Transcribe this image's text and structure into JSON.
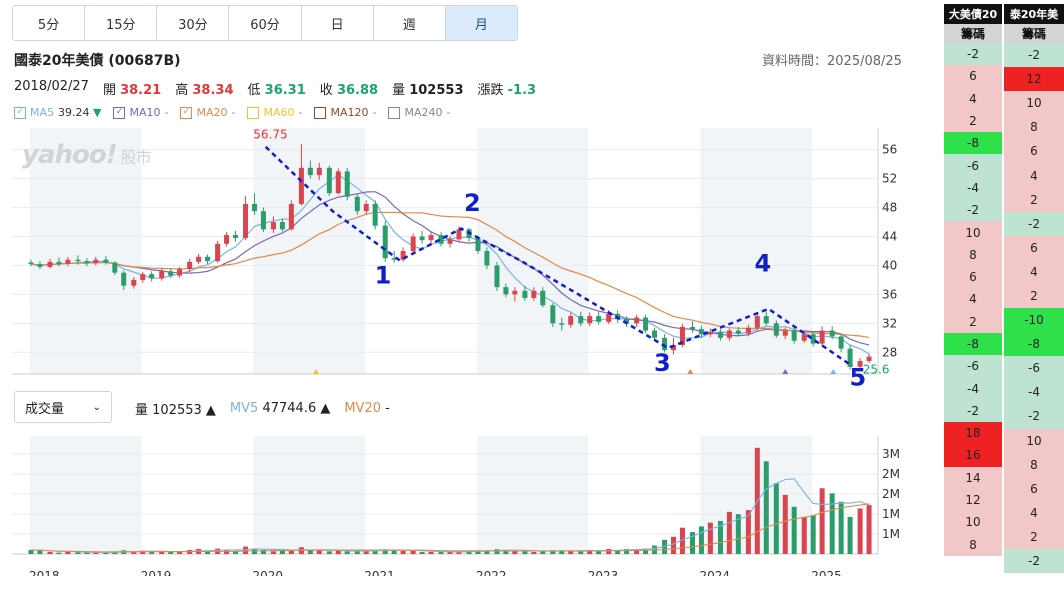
{
  "tabs": [
    {
      "label": "5分",
      "active": false
    },
    {
      "label": "15分",
      "active": false
    },
    {
      "label": "30分",
      "active": false
    },
    {
      "label": "60分",
      "active": false
    },
    {
      "label": "日",
      "active": false
    },
    {
      "label": "週",
      "active": false
    },
    {
      "label": "月",
      "active": true
    }
  ],
  "header": {
    "title": "國泰20年美債 (00687B)",
    "updated": "資料時間：2025/08/25"
  },
  "quote": {
    "date": "2018/02/27",
    "open_label": "開",
    "open": "38.21",
    "high_label": "高",
    "high": "38.34",
    "low_label": "低",
    "low": "36.31",
    "close_label": "收",
    "close": "36.88",
    "vol_label": "量",
    "vol": "102553",
    "chg_label": "漲跌",
    "chg": "-1.3"
  },
  "ma_legend": [
    {
      "label": "MA5",
      "value": "39.24 ▼",
      "color": "#7ab3e0",
      "checked": true
    },
    {
      "label": "MA10",
      "value": "-",
      "color": "#7b68b3",
      "checked": true
    },
    {
      "label": "MA20",
      "value": "-",
      "color": "#e08a4a",
      "checked": true
    },
    {
      "label": "MA60",
      "value": "-",
      "color": "#f2c230",
      "checked": false
    },
    {
      "label": "MA120",
      "value": "-",
      "color": "#8a4b2e",
      "checked": false
    },
    {
      "label": "MA240",
      "value": "-",
      "color": "#888888",
      "checked": false
    }
  ],
  "watermark": {
    "logo": "yahoo!",
    "suffix": "股市"
  },
  "volume_panel": {
    "select_label": "成交量",
    "vol_label": "量",
    "vol_value": "102553 ▲",
    "mv5_label": "MV5",
    "mv5_value": "47744.6 ▲",
    "mv20_label": "MV20",
    "mv20_value": "-"
  },
  "colors": {
    "up": "#d8454f",
    "down": "#2a9d6b",
    "ma5": "#7ab3e0",
    "ma10": "#7b68b3",
    "ma20": "#e08a4a",
    "pattern": "#1020c8",
    "band": "#f2f5f8"
  },
  "chart_data": {
    "type": "candlestick",
    "price_axis": {
      "ticks": [
        "56",
        "52",
        "48",
        "44",
        "40",
        "36",
        "32",
        "28"
      ],
      "range": [
        25,
        59
      ]
    },
    "volume_axis": {
      "ticks": [
        "3M",
        "2M",
        "2M",
        "1M",
        "1M"
      ],
      "range": [
        0,
        3500000
      ]
    },
    "x_ticks": [
      "2018",
      "2019",
      "2020",
      "2021",
      "2022",
      "2023",
      "2024",
      "2025"
    ],
    "x_range": [
      2017.83,
      2025.58
    ],
    "annotations": {
      "high_label": "56.75",
      "high_at": [
        2020.0,
        56.75
      ],
      "low_label": "25.6",
      "low_at": [
        2025.42,
        25.6
      ]
    },
    "pattern_labels": [
      {
        "text": "1",
        "at": [
          2021.15,
          37.5
        ]
      },
      {
        "text": "2",
        "at": [
          2021.95,
          47.5
        ]
      },
      {
        "text": "3",
        "at": [
          2023.65,
          25.4
        ]
      },
      {
        "text": "4",
        "at": [
          2024.55,
          39.2
        ]
      },
      {
        "text": "5",
        "at": [
          2025.4,
          23.4
        ]
      }
    ],
    "pattern_path": [
      [
        2020.1,
        56.4
      ],
      [
        2020.7,
        47.5
      ],
      [
        2021.3,
        40.7
      ],
      [
        2021.85,
        45.1
      ],
      [
        2022.4,
        40.5
      ],
      [
        2022.9,
        36.0
      ],
      [
        2023.7,
        28.6
      ],
      [
        2024.6,
        34.0
      ],
      [
        2025.35,
        26.1
      ]
    ],
    "candles": [
      [
        2018.0,
        40.4,
        40.2,
        40.8,
        39.9,
        3
      ],
      [
        2018.08,
        40.2,
        39.8,
        40.6,
        39.5,
        3
      ],
      [
        2018.17,
        39.8,
        40.5,
        40.9,
        39.6,
        2
      ],
      [
        2018.25,
        40.5,
        40.2,
        41.1,
        39.9,
        1
      ],
      [
        2018.33,
        40.2,
        40.8,
        41.2,
        39.9,
        2
      ],
      [
        2018.42,
        40.8,
        40.6,
        41.4,
        40.1,
        2
      ],
      [
        2018.5,
        40.6,
        40.3,
        41.0,
        39.9,
        1
      ],
      [
        2018.58,
        40.3,
        40.8,
        41.2,
        40.0,
        1
      ],
      [
        2018.67,
        40.8,
        40.4,
        41.3,
        40.1,
        1
      ],
      [
        2018.75,
        40.4,
        39.0,
        40.6,
        38.7,
        2
      ],
      [
        2018.83,
        39.0,
        37.2,
        39.3,
        36.6,
        3
      ],
      [
        2018.92,
        37.2,
        38.0,
        38.4,
        36.8,
        2
      ],
      [
        2019.0,
        38.0,
        38.8,
        39.1,
        37.6,
        3
      ],
      [
        2019.08,
        38.8,
        38.2,
        39.2,
        37.8,
        2
      ],
      [
        2019.17,
        38.2,
        39.2,
        39.6,
        37.9,
        2
      ],
      [
        2019.25,
        39.2,
        38.6,
        39.6,
        38.3,
        2
      ],
      [
        2019.33,
        38.6,
        39.5,
        39.8,
        38.3,
        2
      ],
      [
        2019.42,
        39.5,
        40.5,
        40.9,
        39.1,
        3
      ],
      [
        2019.5,
        40.5,
        41.2,
        41.6,
        40.2,
        4
      ],
      [
        2019.58,
        41.2,
        40.6,
        41.5,
        40.2,
        2
      ],
      [
        2019.67,
        40.6,
        43.0,
        43.4,
        40.4,
        5
      ],
      [
        2019.75,
        43.0,
        44.2,
        44.6,
        42.6,
        4
      ],
      [
        2019.83,
        44.2,
        43.8,
        44.8,
        43.3,
        3
      ],
      [
        2019.92,
        43.8,
        48.5,
        49.6,
        43.5,
        6
      ],
      [
        2020.0,
        48.5,
        47.5,
        50.0,
        47.0,
        5
      ],
      [
        2020.08,
        47.5,
        45.0,
        48.0,
        44.6,
        4
      ],
      [
        2020.17,
        45.0,
        46.0,
        46.8,
        44.5,
        3
      ],
      [
        2020.25,
        46.0,
        45.0,
        46.5,
        44.7,
        3
      ],
      [
        2020.33,
        45.0,
        48.5,
        49.0,
        44.8,
        4
      ],
      [
        2020.42,
        48.5,
        53.5,
        56.75,
        48.3,
        6
      ],
      [
        2020.5,
        53.5,
        52.5,
        54.5,
        52.0,
        4
      ],
      [
        2020.58,
        52.5,
        53.5,
        54.2,
        51.8,
        4
      ],
      [
        2020.67,
        53.5,
        50.0,
        53.8,
        49.6,
        3
      ],
      [
        2020.75,
        50.0,
        53.0,
        53.4,
        49.8,
        4
      ],
      [
        2020.83,
        53.0,
        49.5,
        53.5,
        49.0,
        3
      ],
      [
        2020.92,
        49.5,
        47.5,
        49.9,
        47.0,
        3
      ],
      [
        2021.0,
        47.5,
        48.5,
        49.0,
        47.0,
        3
      ],
      [
        2021.08,
        48.5,
        45.5,
        49.0,
        45.0,
        4
      ],
      [
        2021.17,
        45.5,
        41.0,
        46.2,
        40.5,
        5
      ],
      [
        2021.25,
        41.0,
        40.8,
        42.0,
        40.4,
        4
      ],
      [
        2021.33,
        40.8,
        42.0,
        42.5,
        40.5,
        3
      ],
      [
        2021.42,
        42.0,
        44.0,
        44.4,
        41.8,
        3
      ],
      [
        2021.5,
        44.0,
        43.5,
        44.8,
        43.0,
        2
      ],
      [
        2021.58,
        43.5,
        44.2,
        44.6,
        42.8,
        2
      ],
      [
        2021.67,
        44.2,
        43.0,
        44.6,
        42.6,
        2
      ],
      [
        2021.75,
        43.0,
        43.6,
        44.1,
        42.5,
        2
      ],
      [
        2021.83,
        43.6,
        45.0,
        45.4,
        43.2,
        2
      ],
      [
        2021.92,
        45.0,
        43.8,
        45.2,
        43.3,
        3
      ],
      [
        2022.0,
        43.8,
        42.0,
        44.0,
        41.6,
        4
      ],
      [
        2022.08,
        42.0,
        40.0,
        42.5,
        39.5,
        4
      ],
      [
        2022.17,
        40.0,
        37.0,
        40.5,
        36.5,
        5
      ],
      [
        2022.25,
        37.0,
        36.0,
        37.5,
        35.6,
        4
      ],
      [
        2022.33,
        36.0,
        36.5,
        37.0,
        35.0,
        3
      ],
      [
        2022.42,
        36.5,
        35.5,
        37.2,
        35.1,
        3
      ],
      [
        2022.5,
        35.5,
        36.5,
        37.0,
        35.1,
        2
      ],
      [
        2022.58,
        36.5,
        34.5,
        37.0,
        34.2,
        3
      ],
      [
        2022.67,
        34.5,
        32.0,
        34.8,
        31.5,
        4
      ],
      [
        2022.75,
        32.0,
        31.8,
        32.8,
        31.0,
        4
      ],
      [
        2022.83,
        31.8,
        33.0,
        33.5,
        31.4,
        3
      ],
      [
        2022.92,
        33.0,
        32.0,
        33.6,
        31.6,
        3
      ],
      [
        2023.0,
        32.0,
        33.0,
        33.5,
        31.6,
        4
      ],
      [
        2023.08,
        33.0,
        32.2,
        33.6,
        31.8,
        3
      ],
      [
        2023.17,
        32.2,
        33.3,
        33.8,
        31.9,
        5
      ],
      [
        2023.25,
        33.3,
        32.6,
        33.8,
        32.1,
        4
      ],
      [
        2023.33,
        32.6,
        32.0,
        33.0,
        31.5,
        5
      ],
      [
        2023.42,
        32.0,
        32.8,
        33.2,
        31.5,
        5
      ],
      [
        2023.5,
        32.8,
        31.0,
        33.2,
        30.6,
        5
      ],
      [
        2023.58,
        31.0,
        30.0,
        31.4,
        29.6,
        6
      ],
      [
        2023.67,
        30.0,
        28.3,
        30.5,
        28.0,
        8
      ],
      [
        2023.75,
        28.3,
        29.0,
        30.0,
        27.7,
        9
      ],
      [
        2023.83,
        29.0,
        31.5,
        31.9,
        28.7,
        10
      ],
      [
        2023.92,
        31.5,
        31.2,
        32.3,
        30.7,
        10
      ],
      [
        2024.0,
        31.2,
        30.5,
        31.7,
        30.0,
        11
      ],
      [
        2024.08,
        30.5,
        30.8,
        31.3,
        30.1,
        12
      ],
      [
        2024.17,
        30.8,
        30.0,
        31.2,
        29.6,
        12
      ],
      [
        2024.25,
        30.0,
        31.0,
        31.3,
        29.6,
        15
      ],
      [
        2024.33,
        31.0,
        30.6,
        31.5,
        30.2,
        16
      ],
      [
        2024.42,
        30.6,
        31.4,
        31.8,
        30.2,
        14
      ],
      [
        2024.5,
        31.4,
        33.0,
        33.4,
        31.0,
        24
      ],
      [
        2024.58,
        33.0,
        32.0,
        33.6,
        31.7,
        20
      ],
      [
        2024.67,
        32.0,
        30.3,
        32.4,
        30.0,
        16
      ],
      [
        2024.75,
        30.3,
        31.0,
        31.4,
        29.8,
        13
      ],
      [
        2024.83,
        31.0,
        29.6,
        31.3,
        29.2,
        12
      ],
      [
        2024.92,
        29.6,
        30.5,
        30.9,
        29.3,
        13
      ],
      [
        2025.0,
        30.5,
        29.2,
        30.9,
        28.8,
        14
      ],
      [
        2025.08,
        29.2,
        31.0,
        31.6,
        28.9,
        13
      ],
      [
        2025.17,
        31.0,
        30.2,
        31.6,
        29.8,
        12
      ],
      [
        2025.25,
        30.2,
        28.5,
        30.6,
        28.0,
        14
      ],
      [
        2025.33,
        28.5,
        26.0,
        29.0,
        25.6,
        15
      ],
      [
        2025.42,
        26.0,
        26.8,
        27.2,
        25.8,
        13
      ],
      [
        2025.5,
        26.8,
        27.4,
        27.8,
        26.5,
        12
      ]
    ],
    "volume": {
      "values_k": [
        120,
        110,
        60,
        40,
        70,
        50,
        40,
        40,
        40,
        70,
        110,
        60,
        100,
        70,
        60,
        80,
        60,
        120,
        150,
        60,
        160,
        120,
        90,
        220,
        160,
        120,
        80,
        90,
        130,
        200,
        110,
        100,
        80,
        100,
        80,
        90,
        90,
        110,
        140,
        110,
        90,
        90,
        60,
        60,
        60,
        60,
        60,
        90,
        110,
        110,
        140,
        110,
        90,
        90,
        60,
        90,
        110,
        110,
        90,
        90,
        110,
        90,
        150,
        110,
        150,
        140,
        160,
        250,
        420,
        510,
        780,
        650,
        820,
        930,
        980,
        1250,
        1180,
        1300,
        3150,
        2750,
        2100,
        1750,
        1400,
        1100,
        1150,
        1950,
        1800,
        1550,
        1100,
        1350,
        1450,
        1000
      ],
      "colors_note": "red when close>=open"
    }
  },
  "right_tables": [
    {
      "header": "大美債20",
      "sub": "籌碼",
      "cells": [
        {
          "v": "-2",
          "c": "#bfe3d1"
        },
        {
          "v": "6",
          "c": "#f2c7c7"
        },
        {
          "v": "4",
          "c": "#f2c7c7"
        },
        {
          "v": "2",
          "c": "#f2c7c7"
        },
        {
          "v": "-8",
          "c": "#2ee04a"
        },
        {
          "v": "-6",
          "c": "#bfe3d1"
        },
        {
          "v": "-4",
          "c": "#bfe3d1"
        },
        {
          "v": "-2",
          "c": "#bfe3d1"
        },
        {
          "v": "10",
          "c": "#f2c7c7"
        },
        {
          "v": "8",
          "c": "#f2c7c7"
        },
        {
          "v": "6",
          "c": "#f2c7c7"
        },
        {
          "v": "4",
          "c": "#f2c7c7"
        },
        {
          "v": "2",
          "c": "#f2c7c7"
        },
        {
          "v": "-8",
          "c": "#2ee04a"
        },
        {
          "v": "-6",
          "c": "#bfe3d1"
        },
        {
          "v": "-4",
          "c": "#bfe3d1"
        },
        {
          "v": "-2",
          "c": "#bfe3d1"
        },
        {
          "v": "18",
          "c": "#ee2222"
        },
        {
          "v": "16",
          "c": "#ee2222"
        },
        {
          "v": "14",
          "c": "#f2c7c7"
        },
        {
          "v": "12",
          "c": "#f2c7c7"
        },
        {
          "v": "10",
          "c": "#f2c7c7"
        },
        {
          "v": "8",
          "c": "#f2c7c7"
        }
      ]
    },
    {
      "header": "泰20年美",
      "sub": "籌碼",
      "cells": [
        {
          "v": "-2",
          "c": "#bfe3d1"
        },
        {
          "v": "12",
          "c": "#ee2222"
        },
        {
          "v": "10",
          "c": "#f2c7c7"
        },
        {
          "v": "8",
          "c": "#f2c7c7"
        },
        {
          "v": "6",
          "c": "#f2c7c7"
        },
        {
          "v": "4",
          "c": "#f2c7c7"
        },
        {
          "v": "2",
          "c": "#f2c7c7"
        },
        {
          "v": "-2",
          "c": "#bfe3d1"
        },
        {
          "v": "6",
          "c": "#f2c7c7"
        },
        {
          "v": "4",
          "c": "#f2c7c7"
        },
        {
          "v": "2",
          "c": "#f2c7c7"
        },
        {
          "v": "-10",
          "c": "#2ee04a"
        },
        {
          "v": "-8",
          "c": "#2ee04a"
        },
        {
          "v": "-6",
          "c": "#bfe3d1"
        },
        {
          "v": "-4",
          "c": "#bfe3d1"
        },
        {
          "v": "-2",
          "c": "#bfe3d1"
        },
        {
          "v": "10",
          "c": "#f2c7c7"
        },
        {
          "v": "8",
          "c": "#f2c7c7"
        },
        {
          "v": "6",
          "c": "#f2c7c7"
        },
        {
          "v": "4",
          "c": "#f2c7c7"
        },
        {
          "v": "2",
          "c": "#f2c7c7"
        },
        {
          "v": "-2",
          "c": "#bfe3d1"
        }
      ]
    }
  ]
}
